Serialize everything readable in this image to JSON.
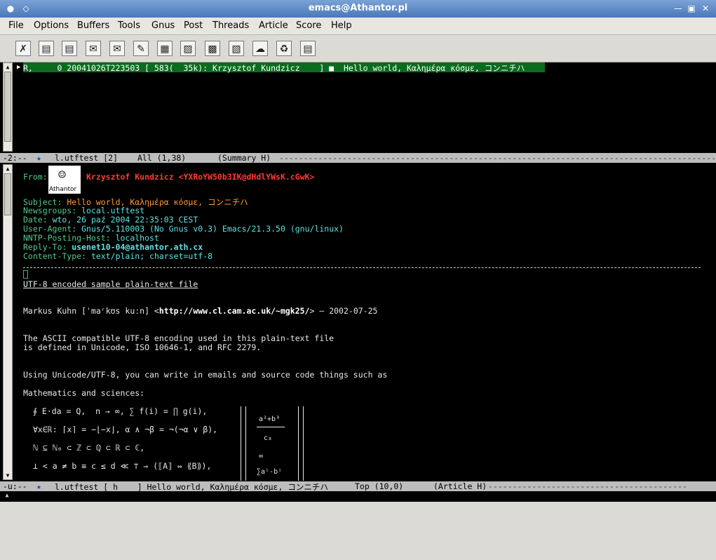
{
  "window": {
    "title": "emacs@Athantor.pl"
  },
  "menu": [
    "File",
    "Options",
    "Buffers",
    "Tools",
    "Gnus",
    "Post",
    "Threads",
    "Article",
    "Score",
    "Help"
  ],
  "toolbar_icons": [
    "exit-icon",
    "get-news-icon",
    "catchup-icon",
    "post-article-icon",
    "followup-icon",
    "mail-reply-icon",
    "uu-decode-icon",
    "save-article-icon",
    "save-mbox-icon",
    "save-file-icon",
    "add-kill-icon",
    "bury-icon",
    "print-icon",
    "info-icon"
  ],
  "summary": {
    "line": "R,     0 20041026T223503 [ 583(  35k): Krzysztof Kundzicz    ] ■  Hello world, Καλημέρα κόσμε, コンニチハ"
  },
  "modeline_top": {
    "prefix": "-2:--",
    "group": "l.utftest [2]",
    "pos": "All (1,38)",
    "mode": "(Summary H)"
  },
  "article": {
    "from_label": "From:",
    "from_value": "Krzysztof Kundzicz <YXRoYW50b3IK@dHdlYWsK.cGwK>",
    "face_text": "Athantor",
    "subject_label": "Subject:",
    "subject_value": "Hello world, Καλημέρα κόσμε, コンニチハ",
    "newsgroups_label": "Newsgroups:",
    "newsgroups_value": "local.utftest",
    "date_label": "Date:",
    "date_value": "wto, 26 paź 2004 22:35:03 CEST",
    "ua_label": "User-Agent:",
    "ua_value": "Gnus/5.110003 (No Gnus v0.3) Emacs/21.3.50 (gnu/linux)",
    "nntp_label": "NNTP-Posting-Host:",
    "nntp_value": "localhost",
    "replyto_label": "Reply-To:",
    "replyto_value": "usenet10-04@athantor.ath.cx",
    "ctype_label": "Content-Type:",
    "ctype_value": "text/plain; charset=utf-8",
    "body": {
      "heading": "UTF-8 encoded sample plain-text file",
      "author_pre": "Markus Kuhn [ˈmaʳkʊs kuːn] <",
      "author_url": "http://www.cl.cam.ac.uk/~mgk25/",
      "author_post": "> — 2002-07-25",
      "p1": "The ASCII compatible UTF-8 encoding used in this plain-text file",
      "p2": "is defined in Unicode, ISO 10646-1, and RFC 2279.",
      "p3": "Using Unicode/UTF-8, you can write in emails and source code things such as",
      "p4": "Mathematics and sciences:",
      "m1": "∮ E⋅da = Q,  n → ∞, ∑ f(i) = ∏ g(i),",
      "m2": "∀x∈ℝ: ⌈x⌉ = −⌊−x⌋, α ∧ ¬β = ¬(¬α ∨ β),",
      "m3": "ℕ ⊆ ℕ₀ ⊂ ℤ ⊂ ℚ ⊂ ℝ ⊂ ℂ,",
      "m4": "⊥ < a ≠ b ≡ c ≤ d ≪ ⊤ ⇒ (⟦A⟧ ⇔ ⟪B⟫),",
      "f1": "a²+b³",
      "f2": "c₈",
      "f3": "∞",
      "f4": "∑aⁱ-bⁱ"
    }
  },
  "modeline_bottom": {
    "prefix": "-u:--",
    "group": "l.utftest [ h    ] Hello world, Καλημέρα κόσμε, コンニチハ",
    "pos": "Top (10,0)",
    "mode": "(Article H)"
  }
}
